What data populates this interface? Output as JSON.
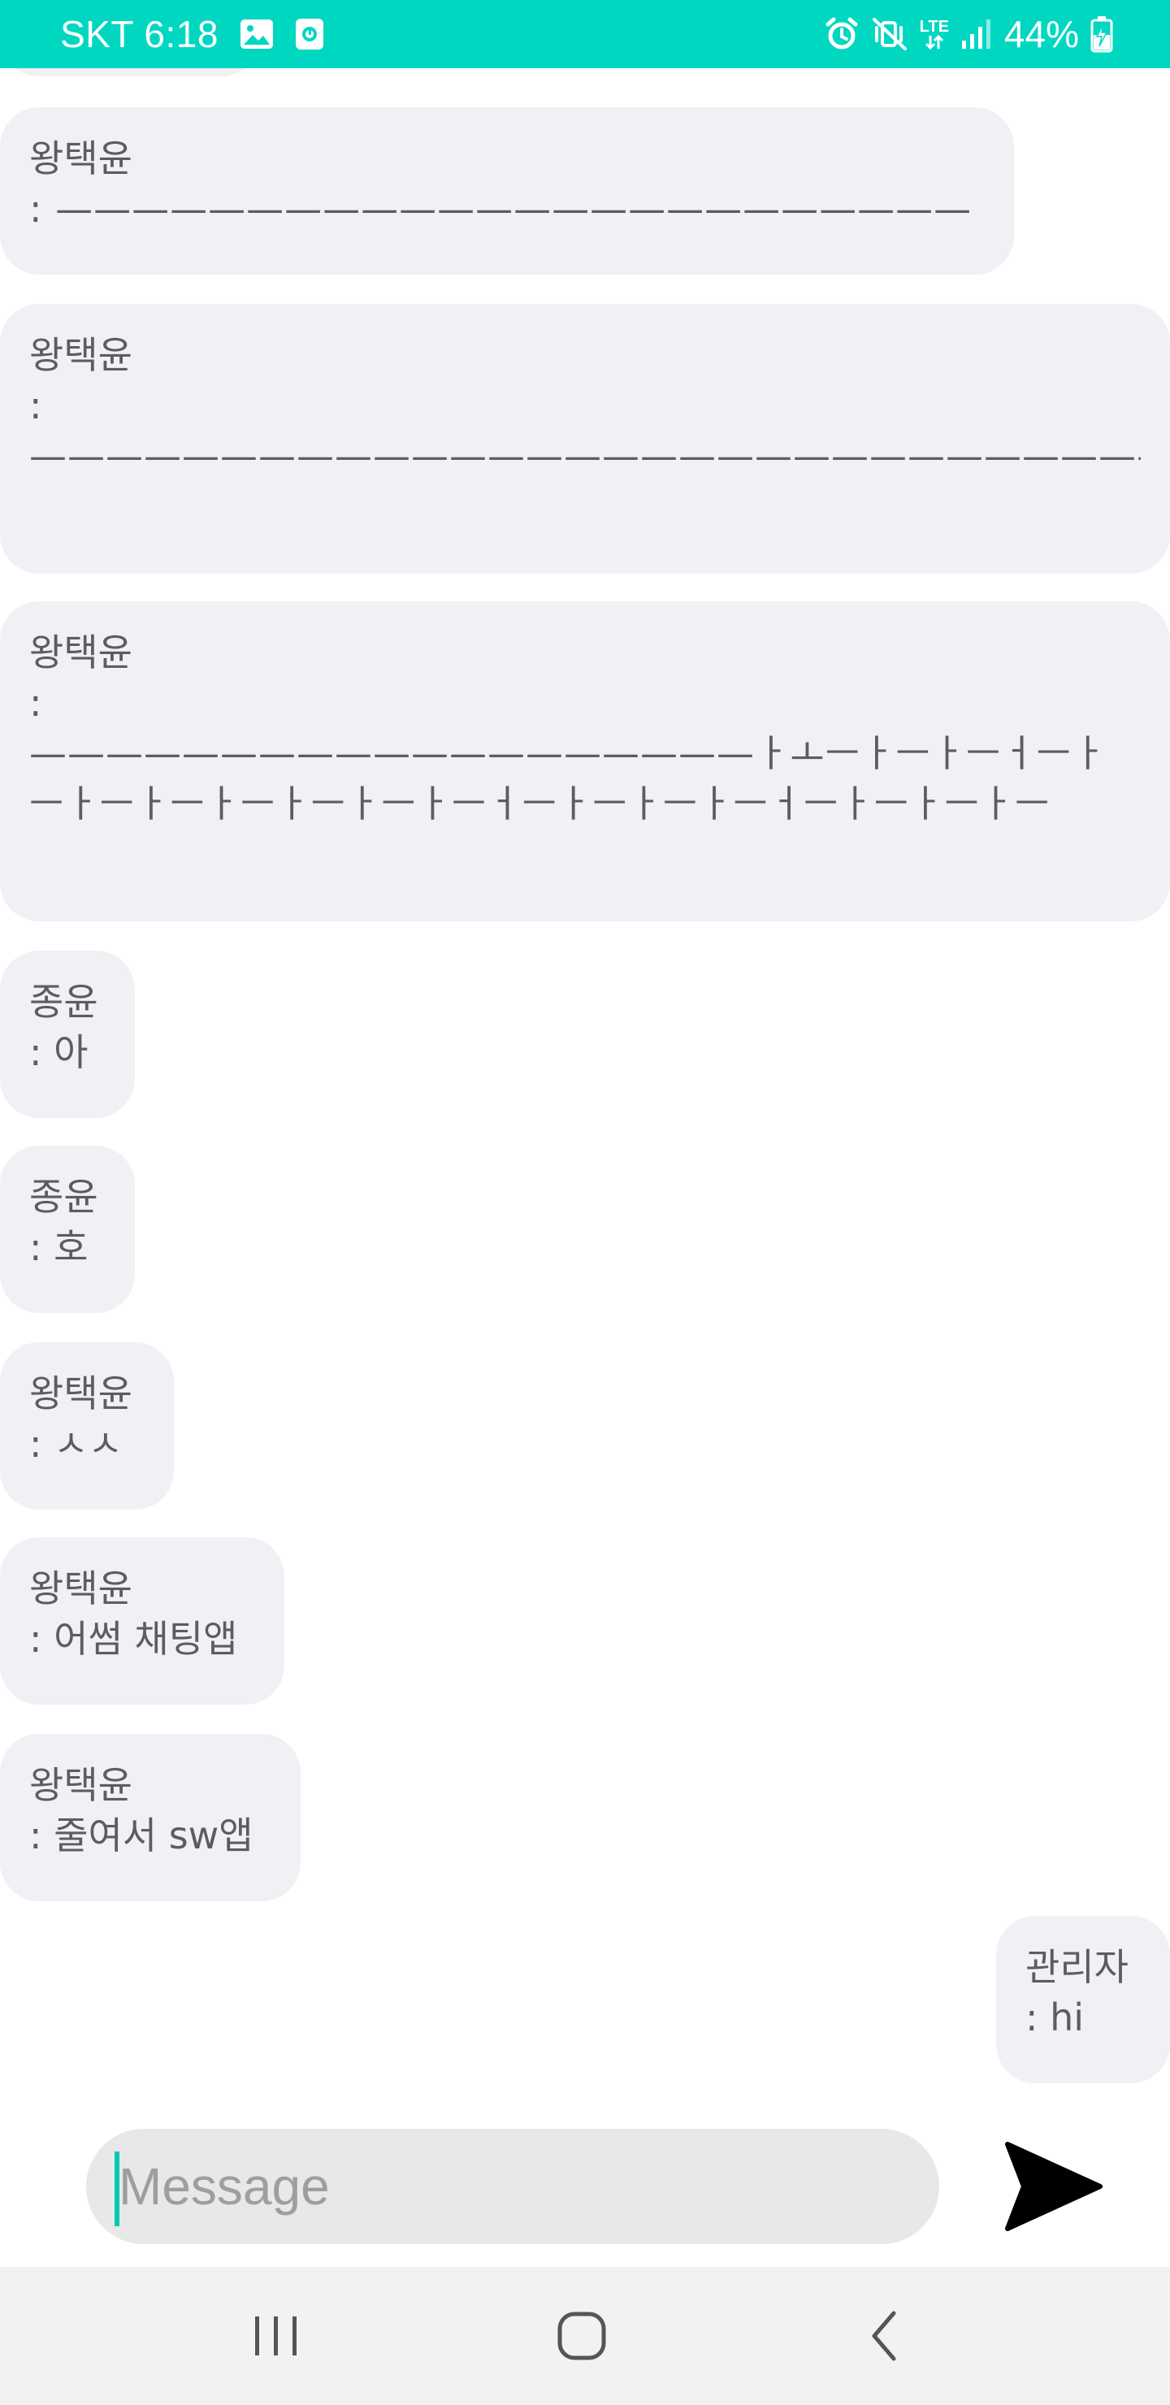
{
  "status_bar": {
    "carrier_time": "SKT 6:18",
    "network": "LTE",
    "battery": "44%",
    "icons": [
      "image-icon",
      "screenshot-icon",
      "alarm-icon",
      "vibrate-mute-icon",
      "lte-data-icon",
      "signal-icon",
      "battery-charging-icon"
    ],
    "background": "#00d7c1"
  },
  "messages": [
    {
      "sender": "왕택윤",
      "text": ": ————————————————————————",
      "side": "left"
    },
    {
      "sender": "왕택윤",
      "text": ":\n————————————————————————————————————————————————————",
      "side": "left"
    },
    {
      "sender": "왕택윤",
      "text": ":\n———————————————————ㅏㅗㅡㅏㅡㅏㅡㅓㅡㅏㅡㅏㅡㅏㅡㅏㅡㅏㅡㅏㅡㅏㅡㅓㅡㅏㅡㅏㅡㅏㅡㅓㅡㅏㅡㅏㅡㅏㅡ",
      "side": "left"
    },
    {
      "sender": "종윤",
      "text": ": 아",
      "side": "left"
    },
    {
      "sender": "종윤",
      "text": ": 호",
      "side": "left"
    },
    {
      "sender": "왕택윤",
      "text": ": ㅅㅅ",
      "side": "left"
    },
    {
      "sender": "왕택윤",
      "text": ": 어썸 채팅앱",
      "side": "left"
    },
    {
      "sender": "왕택윤",
      "text": ": 줄여서 sw앱",
      "side": "left"
    },
    {
      "sender": "관리자",
      "text": ": hi",
      "side": "right"
    }
  ],
  "composer": {
    "placeholder": "Message",
    "value": "",
    "send_icon": "send-icon",
    "caret_color": "#00c9b2"
  },
  "nav_bar": {
    "buttons": [
      "recent-apps-icon",
      "home-icon",
      "back-icon"
    ]
  }
}
